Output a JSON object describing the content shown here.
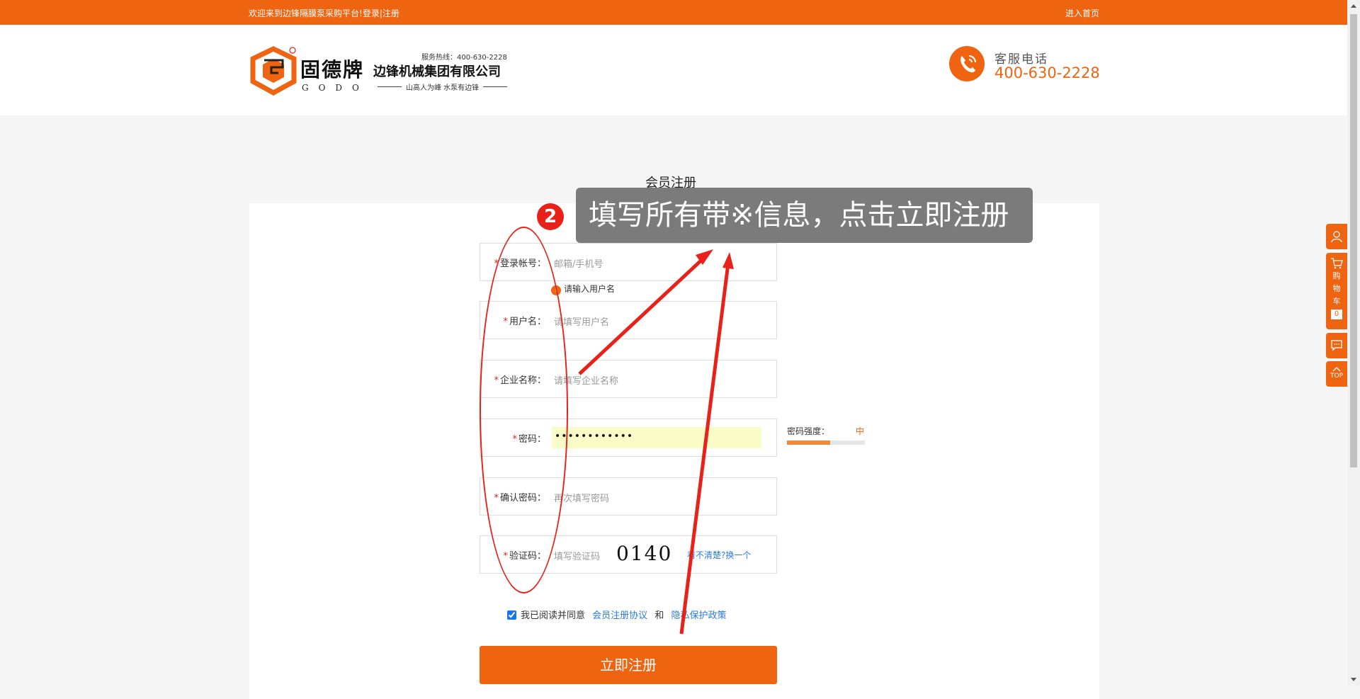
{
  "topbar": {
    "welcome": "欢迎来到边锋隔膜泵采购平台!",
    "login": "登录",
    "sep": "|",
    "register": "注册",
    "home": "进入首页"
  },
  "header": {
    "brand_cn": "固德牌",
    "brand_en": "GODO",
    "hotline": "服务热线：400-630-2228",
    "company": "边锋机械集团有限公司",
    "slogan": "山高人为峰 水泵有边锋",
    "service_label": "客服电话",
    "service_phone": "400-630-2228"
  },
  "form": {
    "title": "会员注册",
    "fields": [
      {
        "label": "登录帐号：",
        "placeholder": "邮箱/手机号"
      },
      {
        "label": "用户名：",
        "placeholder": "请填写用户名"
      },
      {
        "label": "企业名称：",
        "placeholder": "请填写企业名称"
      },
      {
        "label": "密码：",
        "value": "••••••••••••"
      },
      {
        "label": "确认密码：",
        "placeholder": "再次填写密码"
      },
      {
        "label": "验证码：",
        "placeholder": "填写验证码"
      }
    ],
    "required_mark": "*",
    "account_hint": "请输入用户名",
    "strength_label": "密码强度：",
    "strength_level": "中",
    "strength_fraction": 0.55,
    "captcha_text": "0140",
    "captcha_refresh": "看不清楚?换一个",
    "agree_prefix": "我已阅读并同意",
    "agreement_link": "会员注册协议",
    "and": "和",
    "privacy_link": "隐私保护政策",
    "submit": "立即注册"
  },
  "tutorial": {
    "step": "2",
    "text": "填写所有带※信息，点击立即注册"
  },
  "sidebar": {
    "cart_label": "购物车",
    "cart_count": "0",
    "top_label": "TOP"
  },
  "colors": {
    "accent": "#ee6410",
    "annotation": "#e8221a",
    "link": "#2a7bde"
  }
}
